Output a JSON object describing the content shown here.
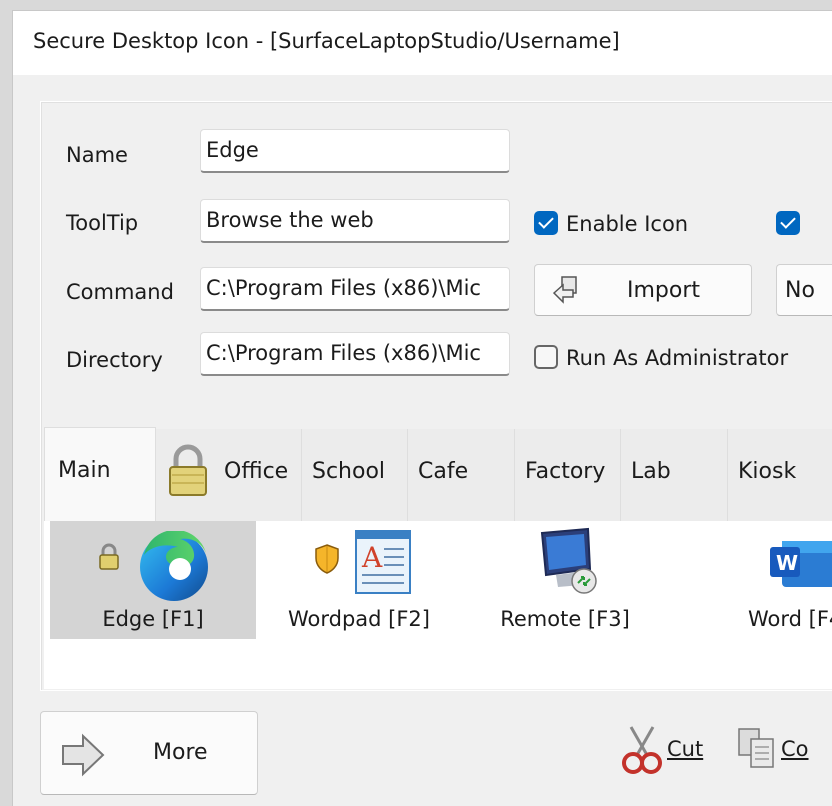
{
  "window": {
    "title": "Secure Desktop Icon - [SurfaceLaptopStudio/Username]"
  },
  "form": {
    "name_label": "Name",
    "name_value": "Edge",
    "tooltip_label": "ToolTip",
    "tooltip_value": "Browse the web",
    "command_label": "Command",
    "command_value": "C:\\Program Files (x86)\\Mic",
    "directory_label": "Directory",
    "directory_value": "C:\\Program Files (x86)\\Mic",
    "enable_icon_label": "Enable Icon",
    "enable_icon_checked": true,
    "second_checkbox_checked": true,
    "run_as_admin_label": "Run As Administrator",
    "run_as_admin_checked": false,
    "import_button_label": "Import",
    "dropdown_value": "No"
  },
  "tabs": [
    {
      "label": "Main",
      "active": true
    },
    {
      "label": "Office",
      "icon": "padlock-icon"
    },
    {
      "label": "School"
    },
    {
      "label": "Cafe"
    },
    {
      "label": "Factory"
    },
    {
      "label": "Lab"
    },
    {
      "label": "Kiosk"
    }
  ],
  "icons": [
    {
      "label": "Edge [F1]",
      "selected": true,
      "badge": "padlock-icon",
      "icon": "edge-icon"
    },
    {
      "label": "Wordpad [F2]",
      "badge": "shield-icon",
      "icon": "wordpad-icon"
    },
    {
      "label": "Remote [F3]",
      "icon": "remote-desktop-icon"
    },
    {
      "label": "Word [F4",
      "icon": "word-icon"
    }
  ],
  "bottom": {
    "more_label": "More",
    "cut_label": "Cut",
    "copy_label": "Co"
  },
  "colors": {
    "accent": "#0067c0",
    "selection": "#d4d4d4"
  }
}
